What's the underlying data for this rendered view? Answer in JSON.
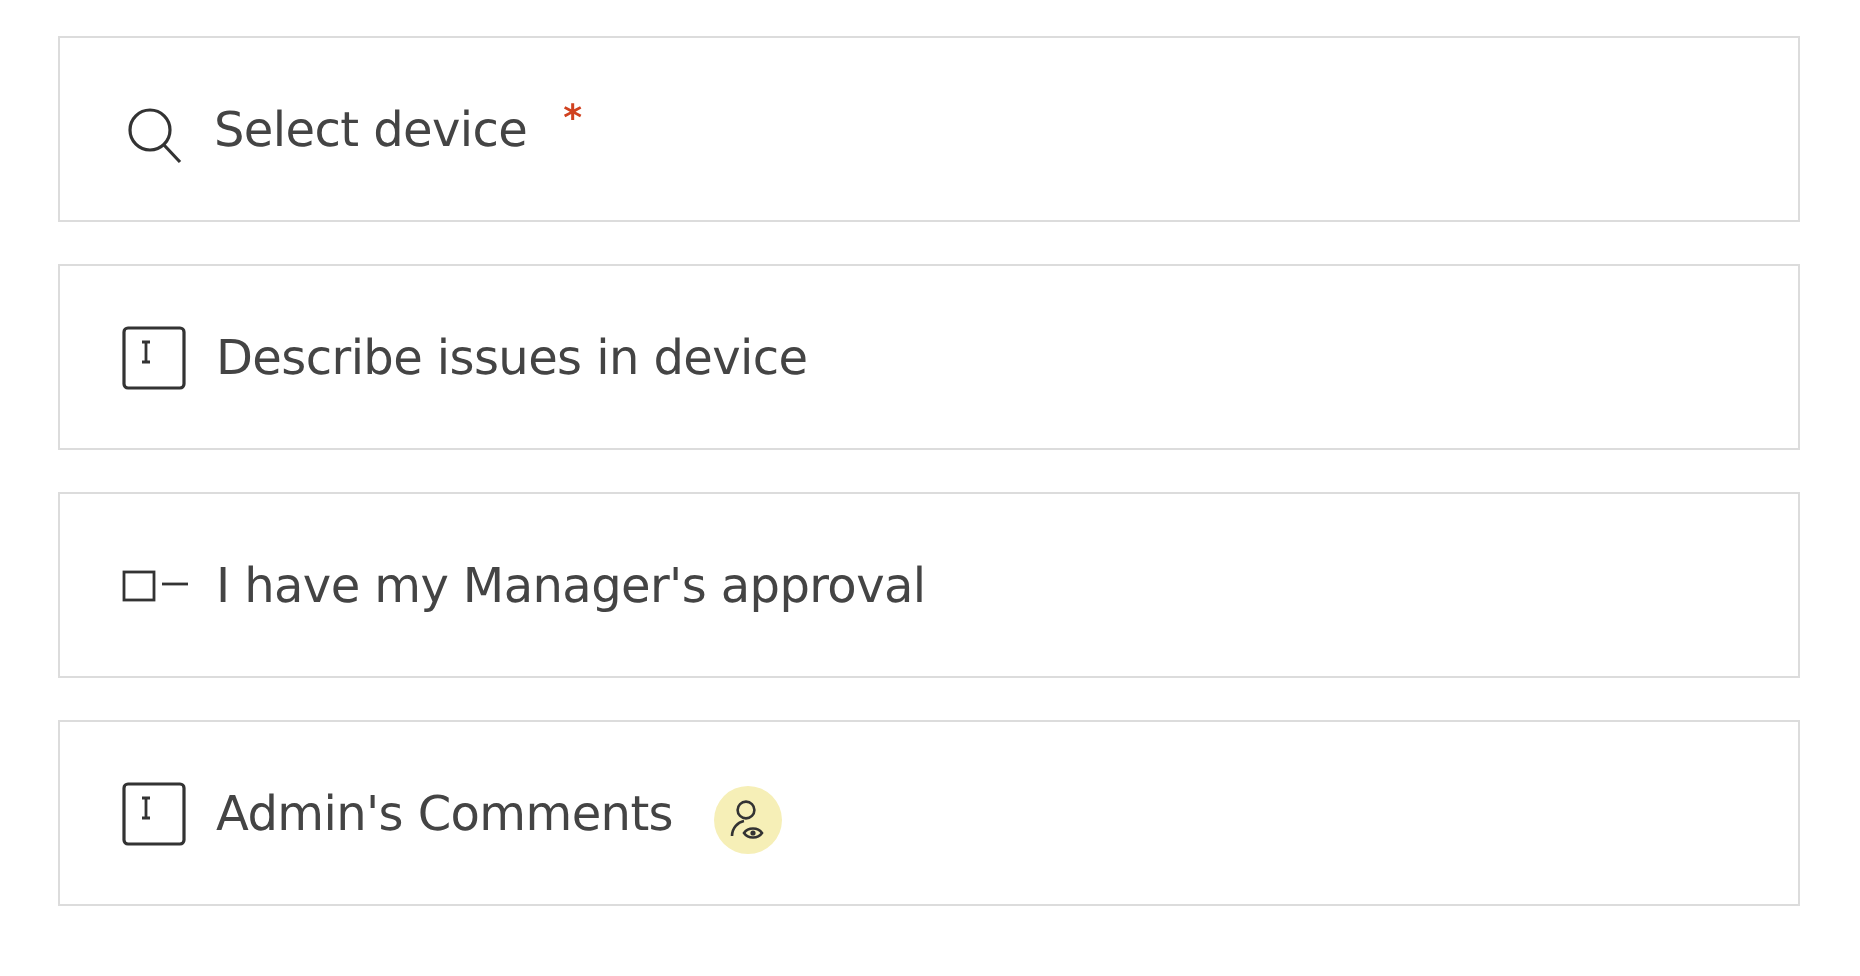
{
  "fields": [
    {
      "kind": "lookup",
      "label": "Select device",
      "required_mark": "*",
      "admin_only": false
    },
    {
      "kind": "text",
      "label": "Describe issues in device",
      "admin_only": false
    },
    {
      "kind": "checkbox",
      "label": "I have my Manager's approval",
      "admin_only": false
    },
    {
      "kind": "text",
      "label": "Admin's Comments",
      "admin_only": true
    }
  ]
}
